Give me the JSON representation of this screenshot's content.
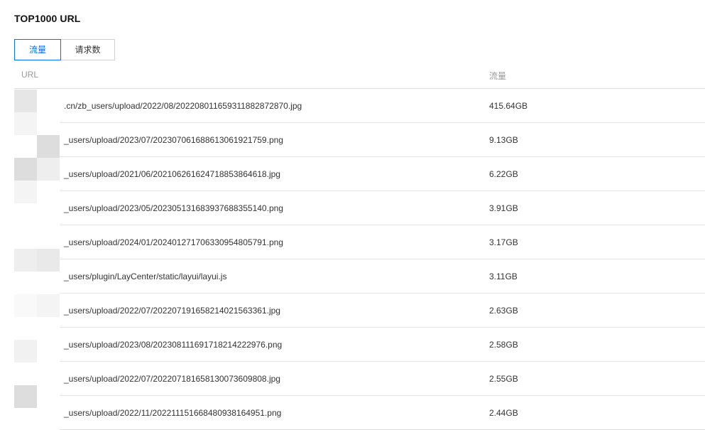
{
  "panel": {
    "title": "TOP1000 URL"
  },
  "tabs": [
    {
      "label": "流量",
      "active": true
    },
    {
      "label": "请求数",
      "active": false
    }
  ],
  "table": {
    "columns": {
      "url": "URL",
      "traffic": "流量"
    },
    "rows": [
      {
        "url": ".cn/zb_users/upload/2022/08/202208011659311882872870.jpg",
        "traffic": "415.64GB"
      },
      {
        "url": "_users/upload/2023/07/202307061688613061921759.png",
        "traffic": "9.13GB"
      },
      {
        "url": "_users/upload/2021/06/202106261624718853864618.jpg",
        "traffic": "6.22GB"
      },
      {
        "url": "_users/upload/2023/05/202305131683937688355140.png",
        "traffic": "3.91GB"
      },
      {
        "url": "_users/upload/2024/01/202401271706330954805791.png",
        "traffic": "3.17GB"
      },
      {
        "url": "_users/plugin/LayCenter/static/layui/layui.js",
        "traffic": "3.11GB"
      },
      {
        "url": "_users/upload/2022/07/202207191658214021563361.jpg",
        "traffic": "2.63GB"
      },
      {
        "url": "_users/upload/2023/08/202308111691718214222976.png",
        "traffic": "2.58GB"
      },
      {
        "url": "_users/upload/2022/07/202207181658130073609808.jpg",
        "traffic": "2.55GB"
      },
      {
        "url": "_users/upload/2022/11/202211151668480938164951.png",
        "traffic": "2.44GB"
      }
    ]
  },
  "colors": {
    "accent": "#006eff",
    "header_text": "#999999",
    "body_text": "#333333",
    "mosaic_tones": [
      "#e6e6e6",
      "#eeeeee",
      "#f4f4f4",
      "#dddddd",
      "#f9f9f9",
      "#e9e9e9",
      "#ffffff",
      "#f1f1f1"
    ]
  }
}
